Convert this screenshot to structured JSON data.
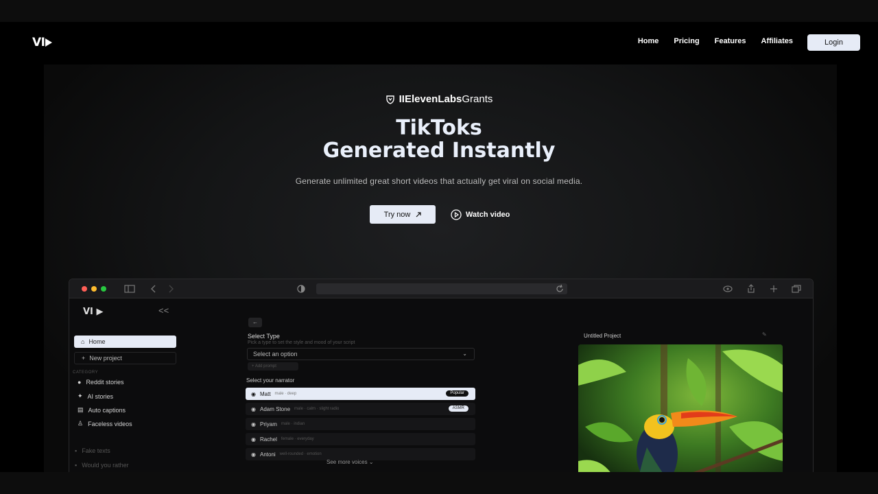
{
  "nav": {
    "logo": "VI",
    "links": [
      "Home",
      "Pricing",
      "Features",
      "Affiliates"
    ],
    "login_label": "Login"
  },
  "hero": {
    "badge_brand": "IIElevenLabs",
    "badge_suffix": "Grants",
    "title_line1": "TikToks",
    "title_line2": "Generated Instantly",
    "subtitle": "Generate unlimited great short videos that actually get viral on social media.",
    "try_label": "Try now",
    "watch_label": "Watch video"
  },
  "app": {
    "logo": "VI",
    "collapse": "<<",
    "home_label": "Home",
    "new_project_label": "New project",
    "category_label": "CATEGORY",
    "categories": [
      "Reddit stories",
      "AI stories",
      "Auto captions",
      "Faceless videos"
    ],
    "dim_items": [
      "Fake texts",
      "Would you rather"
    ],
    "select_type_title": "Select Type",
    "select_type_hint": "Pick a type to set the style and mood of your script",
    "select_placeholder": "Select an option",
    "add_prompt": "+ Add prompt",
    "narrator_title": "Select your narrator",
    "voices": [
      {
        "name": "Matt",
        "meta": "male · deep",
        "tag": "Popular"
      },
      {
        "name": "Adam Stone",
        "meta": "male · calm · slight radio",
        "tag": "ASMR"
      },
      {
        "name": "Priyam",
        "meta": "male · indian",
        "tag": ""
      },
      {
        "name": "Rachel",
        "meta": "female · everyday",
        "tag": ""
      },
      {
        "name": "Antoni",
        "meta": "well-rounded · emotion",
        "tag": ""
      }
    ],
    "see_more": "See more voices",
    "project_title": "Untitled Project"
  },
  "colors": {
    "accent_button": "#e6ebf6",
    "title_text": "#eaf0fb",
    "traffic_red": "#ff5f57",
    "traffic_yellow": "#febc2e",
    "traffic_green": "#28c840"
  }
}
